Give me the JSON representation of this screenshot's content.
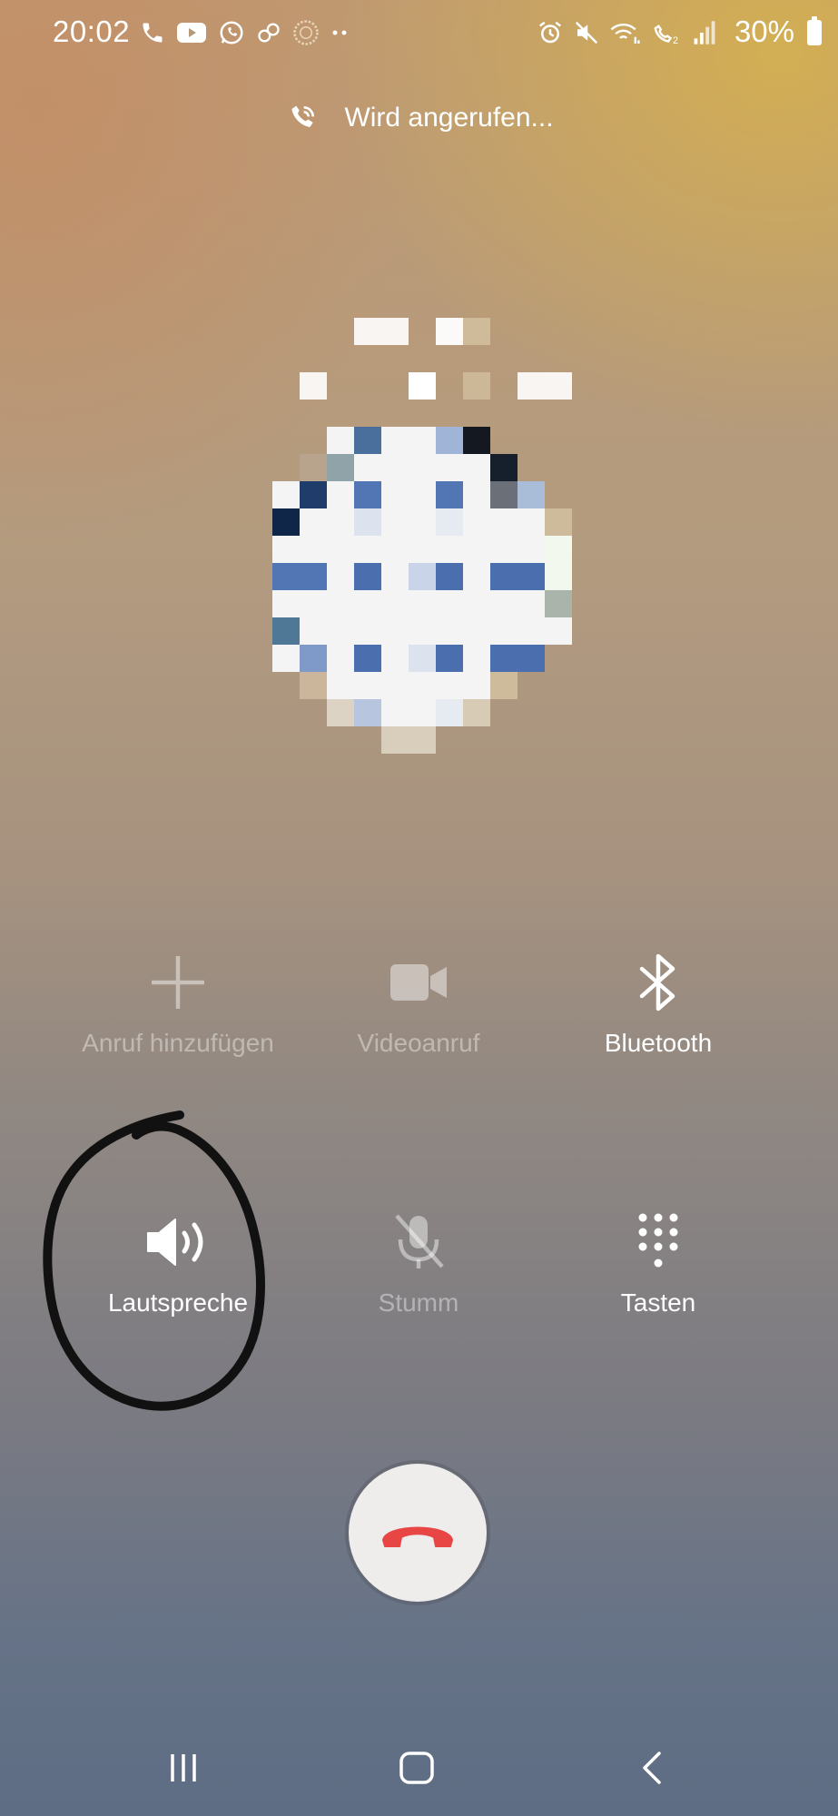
{
  "status_bar": {
    "time": "20:02",
    "left_icons": [
      "phone-icon",
      "youtube-icon",
      "whatsapp-icon",
      "link-icon",
      "clock-app-icon",
      "more-dots-icon"
    ],
    "right_icons": [
      "alarm-icon",
      "mute-icon",
      "wifi-calling-icon",
      "volte-2-icon",
      "signal-icon"
    ],
    "battery_percent": "30%"
  },
  "call": {
    "status_text": "Wird angerufen..."
  },
  "actions": {
    "add_call": {
      "label": "Anruf hinzufügen",
      "enabled": false
    },
    "video_call": {
      "label": "Videoanruf",
      "enabled": false
    },
    "bluetooth": {
      "label": "Bluetooth",
      "enabled": true
    },
    "speaker": {
      "label": "Lautspreche",
      "enabled": true
    },
    "mute": {
      "label": "Stumm",
      "enabled": false
    },
    "keypad": {
      "label": "Tasten",
      "enabled": true
    }
  },
  "end_call": {
    "icon": "hang-up-icon",
    "color": "#e84545"
  },
  "nav": {
    "icons": [
      "recent-apps-icon",
      "home-icon",
      "back-icon"
    ]
  }
}
